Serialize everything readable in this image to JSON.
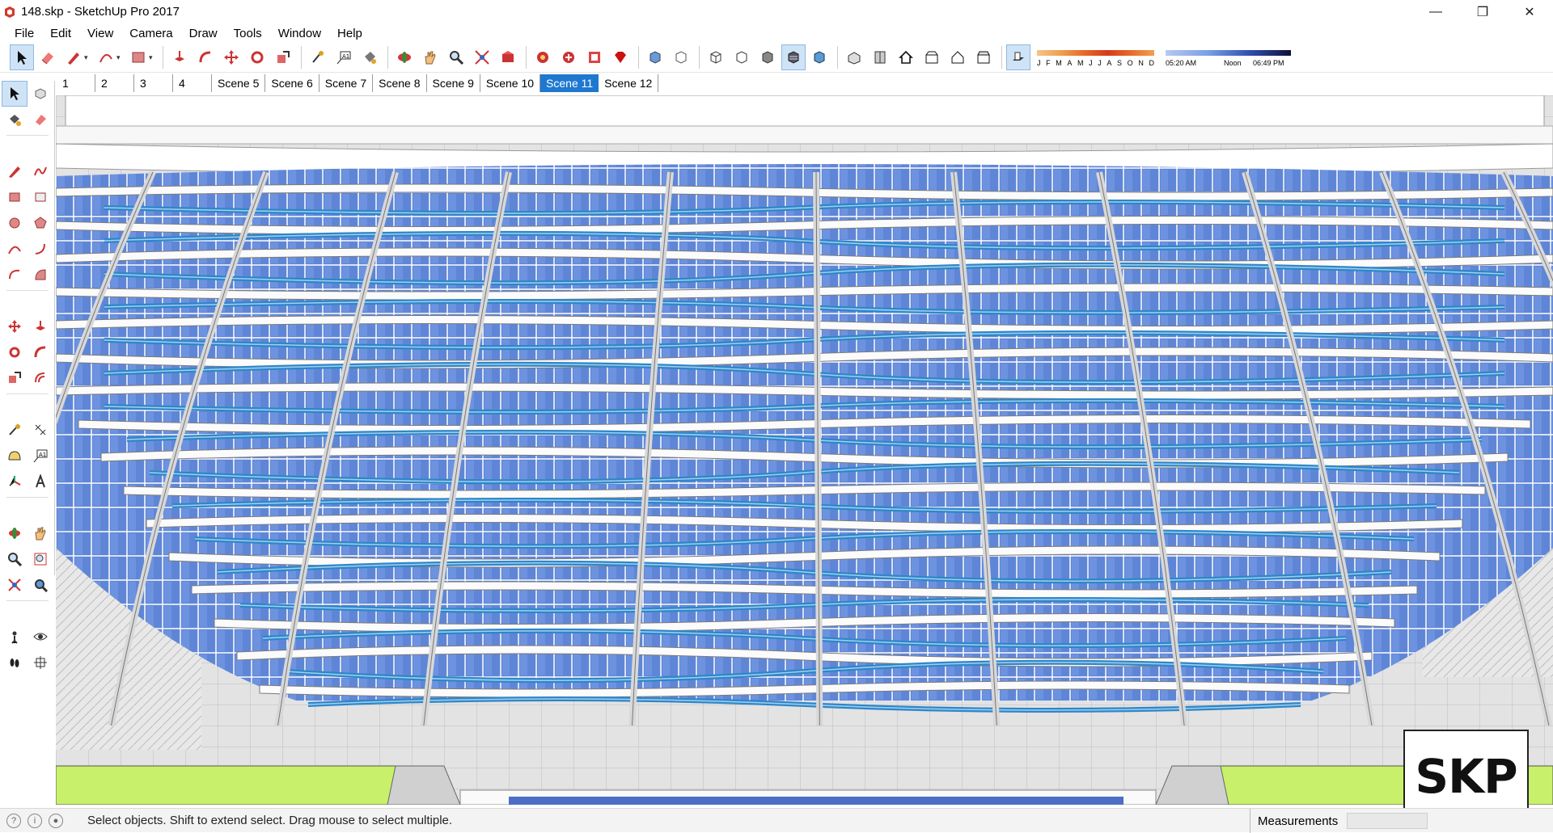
{
  "window": {
    "title": "148.skp - SketchUp Pro 2017",
    "controls": [
      "minimize",
      "restore",
      "close"
    ]
  },
  "menu": [
    "File",
    "Edit",
    "View",
    "Camera",
    "Draw",
    "Tools",
    "Window",
    "Help"
  ],
  "toolbar": {
    "months_labels": [
      "J",
      "F",
      "M",
      "A",
      "M",
      "J",
      "J",
      "A",
      "S",
      "O",
      "N",
      "D"
    ],
    "time_start": "05:20 AM",
    "time_mid": "Noon",
    "time_end": "06:49 PM"
  },
  "scenes": {
    "tabs": [
      "1",
      "2",
      "3",
      "4",
      "Scene 5",
      "Scene 6",
      "Scene 7",
      "Scene 8",
      "Scene 9",
      "Scene 10",
      "Scene 11",
      "Scene 12"
    ],
    "active": "Scene 11"
  },
  "status": {
    "text": "Select objects. Shift to extend select. Drag mouse to select multiple.",
    "measurements_label": "Measurements",
    "measurements_value": ""
  },
  "watermark": {
    "text": "SKP"
  },
  "colors": {
    "accent": "#1e78d0",
    "glass": "#5b84d8",
    "railing": "#2f86c8",
    "ground": "#c8f06a"
  }
}
